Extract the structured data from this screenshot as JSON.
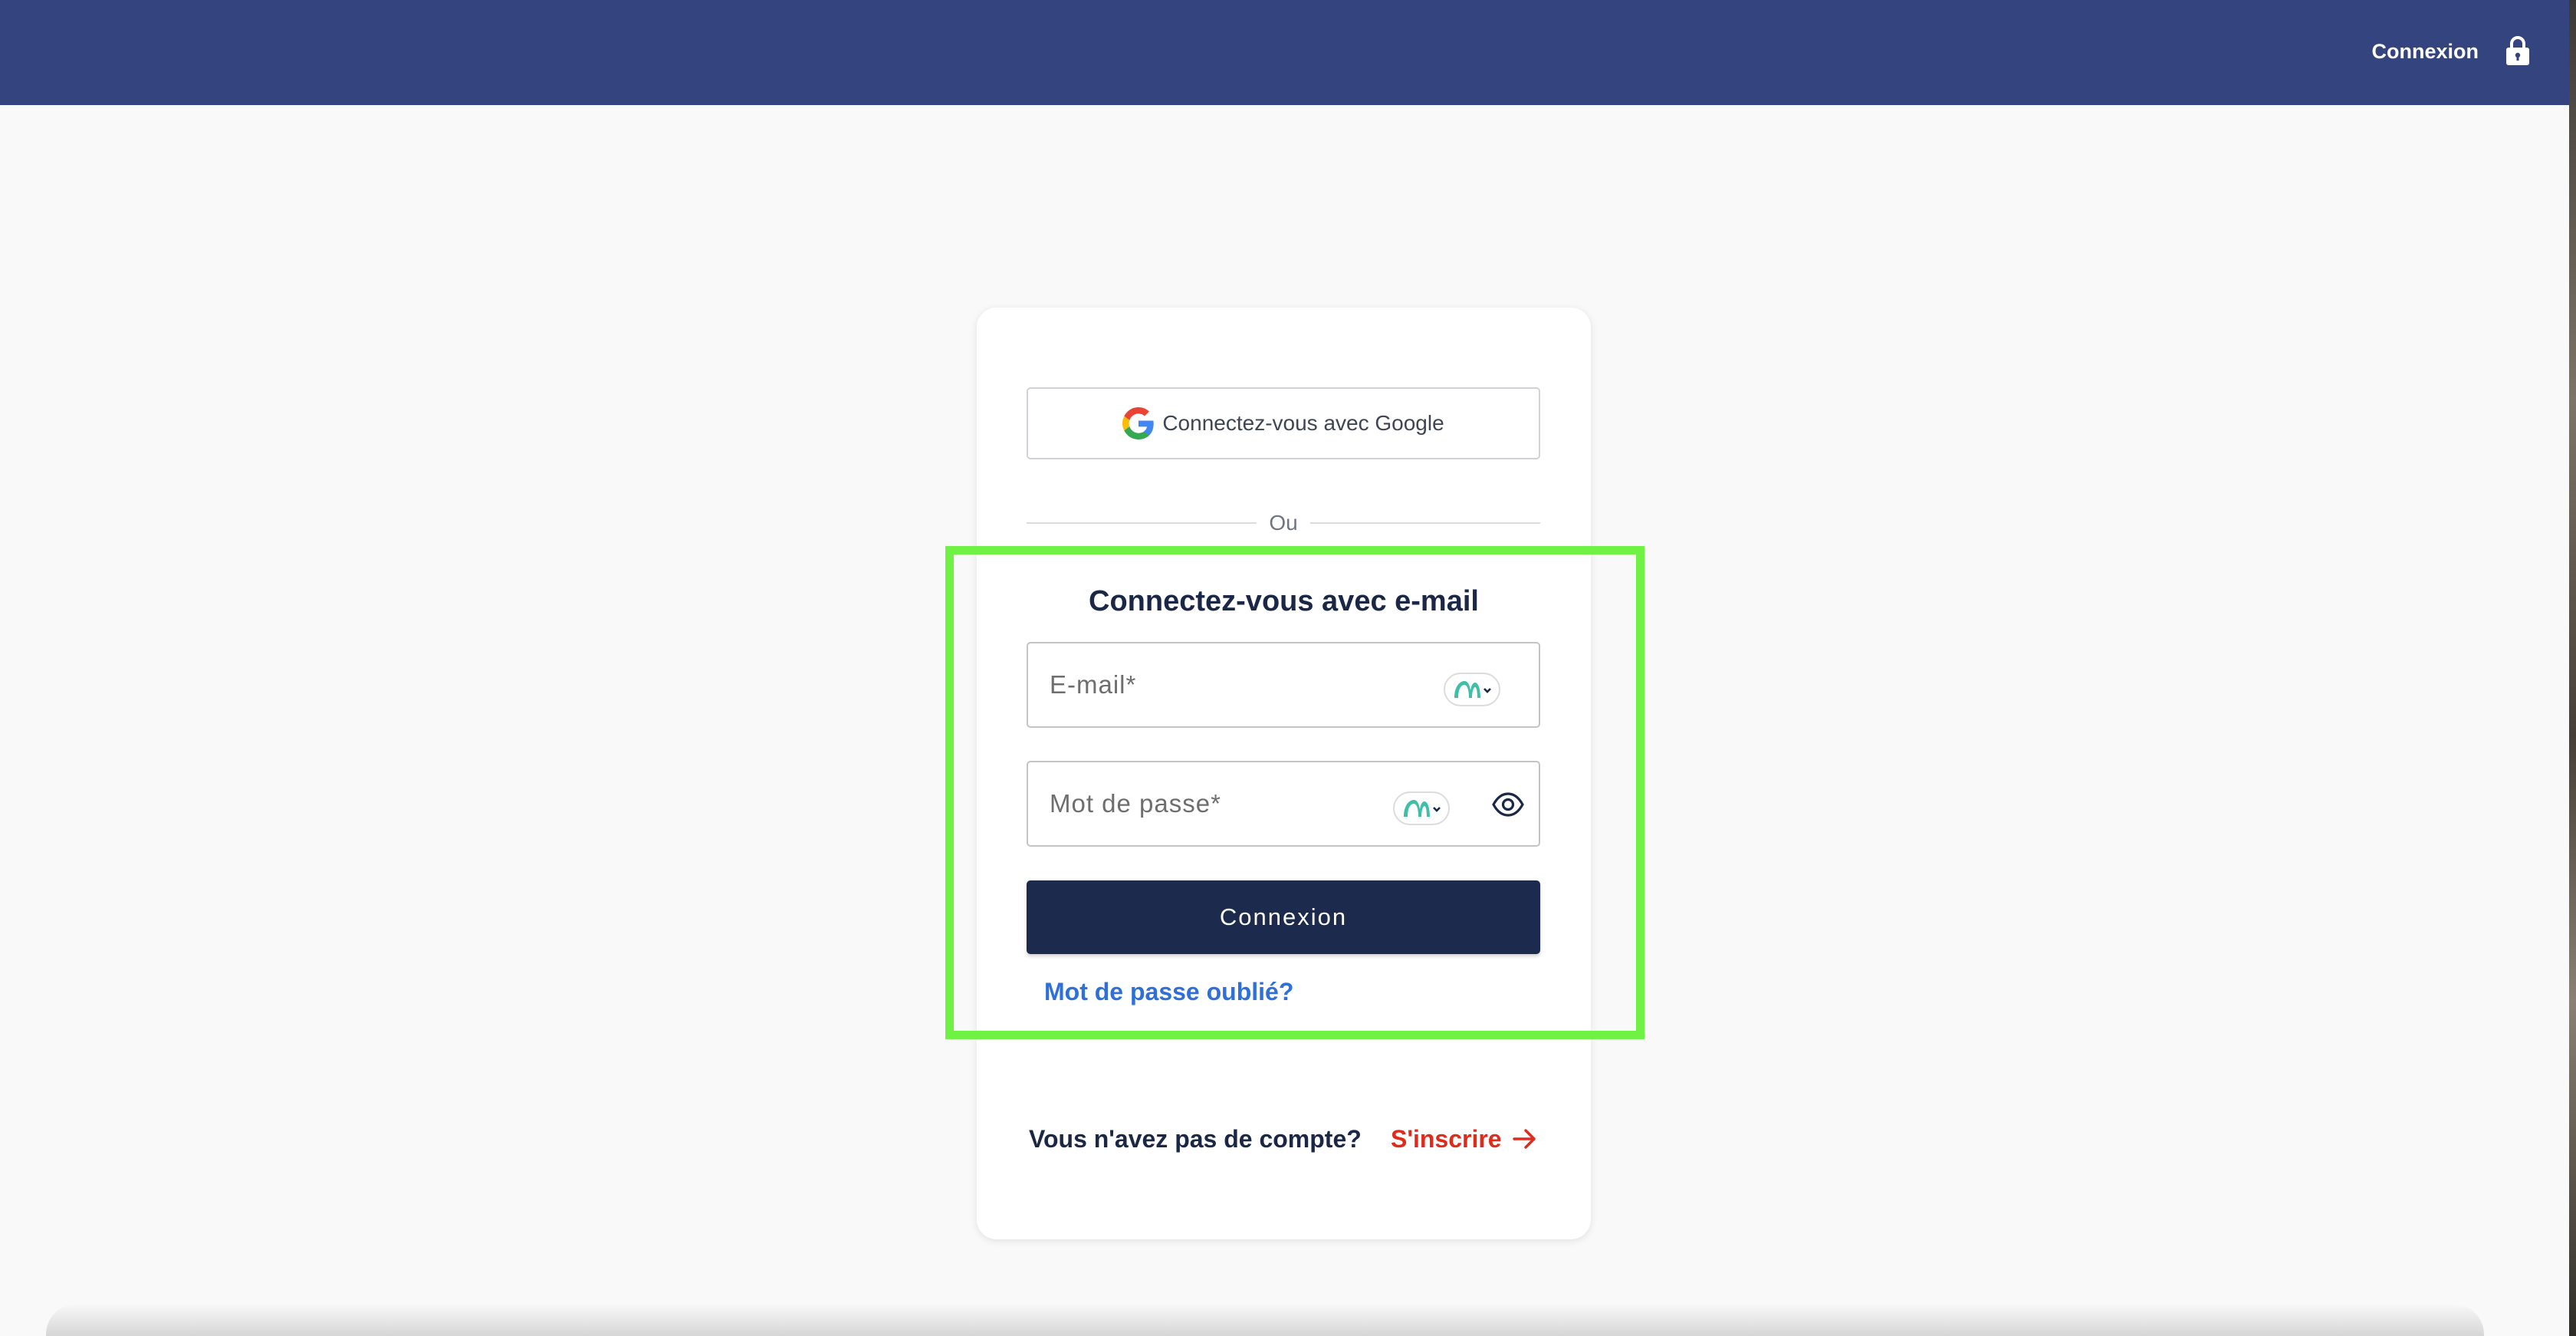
{
  "header": {
    "login_label": "Connexion",
    "lock_icon": "lock-icon",
    "background_color": "#34447e"
  },
  "card": {
    "google_button_label": "Connectez-vous avec Google",
    "google_icon": "google-g-icon",
    "divider_text": "Ou",
    "email_section_title": "Connectez-vous avec e-mail",
    "email_placeholder": "E-mail*",
    "email_value": "",
    "password_placeholder": "Mot de passe*",
    "password_value": "",
    "password_manager_icon": "password-manager-icon",
    "show_password_icon": "eye-icon",
    "submit_label": "Connexion",
    "forgot_password_label": "Mot de passe oublié?",
    "no_account_text": "Vous n'avez pas de compte?",
    "signup_label": "S'inscrire",
    "signup_arrow_icon": "arrow-right-icon"
  },
  "colors": {
    "primary_button": "#1b2a4d",
    "link_blue": "#2f6fda",
    "signup_red": "#e02b1a",
    "highlight_green": "#70f244"
  }
}
